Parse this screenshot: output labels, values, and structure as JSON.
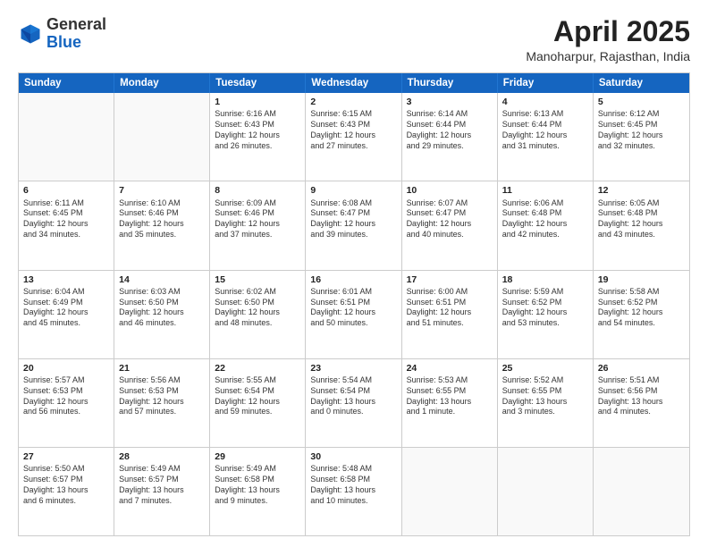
{
  "header": {
    "logo_general": "General",
    "logo_blue": "Blue",
    "month_title": "April 2025",
    "location": "Manoharpur, Rajasthan, India"
  },
  "weekdays": [
    "Sunday",
    "Monday",
    "Tuesday",
    "Wednesday",
    "Thursday",
    "Friday",
    "Saturday"
  ],
  "rows": [
    [
      {
        "day": "",
        "lines": []
      },
      {
        "day": "",
        "lines": []
      },
      {
        "day": "1",
        "lines": [
          "Sunrise: 6:16 AM",
          "Sunset: 6:43 PM",
          "Daylight: 12 hours",
          "and 26 minutes."
        ]
      },
      {
        "day": "2",
        "lines": [
          "Sunrise: 6:15 AM",
          "Sunset: 6:43 PM",
          "Daylight: 12 hours",
          "and 27 minutes."
        ]
      },
      {
        "day": "3",
        "lines": [
          "Sunrise: 6:14 AM",
          "Sunset: 6:44 PM",
          "Daylight: 12 hours",
          "and 29 minutes."
        ]
      },
      {
        "day": "4",
        "lines": [
          "Sunrise: 6:13 AM",
          "Sunset: 6:44 PM",
          "Daylight: 12 hours",
          "and 31 minutes."
        ]
      },
      {
        "day": "5",
        "lines": [
          "Sunrise: 6:12 AM",
          "Sunset: 6:45 PM",
          "Daylight: 12 hours",
          "and 32 minutes."
        ]
      }
    ],
    [
      {
        "day": "6",
        "lines": [
          "Sunrise: 6:11 AM",
          "Sunset: 6:45 PM",
          "Daylight: 12 hours",
          "and 34 minutes."
        ]
      },
      {
        "day": "7",
        "lines": [
          "Sunrise: 6:10 AM",
          "Sunset: 6:46 PM",
          "Daylight: 12 hours",
          "and 35 minutes."
        ]
      },
      {
        "day": "8",
        "lines": [
          "Sunrise: 6:09 AM",
          "Sunset: 6:46 PM",
          "Daylight: 12 hours",
          "and 37 minutes."
        ]
      },
      {
        "day": "9",
        "lines": [
          "Sunrise: 6:08 AM",
          "Sunset: 6:47 PM",
          "Daylight: 12 hours",
          "and 39 minutes."
        ]
      },
      {
        "day": "10",
        "lines": [
          "Sunrise: 6:07 AM",
          "Sunset: 6:47 PM",
          "Daylight: 12 hours",
          "and 40 minutes."
        ]
      },
      {
        "day": "11",
        "lines": [
          "Sunrise: 6:06 AM",
          "Sunset: 6:48 PM",
          "Daylight: 12 hours",
          "and 42 minutes."
        ]
      },
      {
        "day": "12",
        "lines": [
          "Sunrise: 6:05 AM",
          "Sunset: 6:48 PM",
          "Daylight: 12 hours",
          "and 43 minutes."
        ]
      }
    ],
    [
      {
        "day": "13",
        "lines": [
          "Sunrise: 6:04 AM",
          "Sunset: 6:49 PM",
          "Daylight: 12 hours",
          "and 45 minutes."
        ]
      },
      {
        "day": "14",
        "lines": [
          "Sunrise: 6:03 AM",
          "Sunset: 6:50 PM",
          "Daylight: 12 hours",
          "and 46 minutes."
        ]
      },
      {
        "day": "15",
        "lines": [
          "Sunrise: 6:02 AM",
          "Sunset: 6:50 PM",
          "Daylight: 12 hours",
          "and 48 minutes."
        ]
      },
      {
        "day": "16",
        "lines": [
          "Sunrise: 6:01 AM",
          "Sunset: 6:51 PM",
          "Daylight: 12 hours",
          "and 50 minutes."
        ]
      },
      {
        "day": "17",
        "lines": [
          "Sunrise: 6:00 AM",
          "Sunset: 6:51 PM",
          "Daylight: 12 hours",
          "and 51 minutes."
        ]
      },
      {
        "day": "18",
        "lines": [
          "Sunrise: 5:59 AM",
          "Sunset: 6:52 PM",
          "Daylight: 12 hours",
          "and 53 minutes."
        ]
      },
      {
        "day": "19",
        "lines": [
          "Sunrise: 5:58 AM",
          "Sunset: 6:52 PM",
          "Daylight: 12 hours",
          "and 54 minutes."
        ]
      }
    ],
    [
      {
        "day": "20",
        "lines": [
          "Sunrise: 5:57 AM",
          "Sunset: 6:53 PM",
          "Daylight: 12 hours",
          "and 56 minutes."
        ]
      },
      {
        "day": "21",
        "lines": [
          "Sunrise: 5:56 AM",
          "Sunset: 6:53 PM",
          "Daylight: 12 hours",
          "and 57 minutes."
        ]
      },
      {
        "day": "22",
        "lines": [
          "Sunrise: 5:55 AM",
          "Sunset: 6:54 PM",
          "Daylight: 12 hours",
          "and 59 minutes."
        ]
      },
      {
        "day": "23",
        "lines": [
          "Sunrise: 5:54 AM",
          "Sunset: 6:54 PM",
          "Daylight: 13 hours",
          "and 0 minutes."
        ]
      },
      {
        "day": "24",
        "lines": [
          "Sunrise: 5:53 AM",
          "Sunset: 6:55 PM",
          "Daylight: 13 hours",
          "and 1 minute."
        ]
      },
      {
        "day": "25",
        "lines": [
          "Sunrise: 5:52 AM",
          "Sunset: 6:55 PM",
          "Daylight: 13 hours",
          "and 3 minutes."
        ]
      },
      {
        "day": "26",
        "lines": [
          "Sunrise: 5:51 AM",
          "Sunset: 6:56 PM",
          "Daylight: 13 hours",
          "and 4 minutes."
        ]
      }
    ],
    [
      {
        "day": "27",
        "lines": [
          "Sunrise: 5:50 AM",
          "Sunset: 6:57 PM",
          "Daylight: 13 hours",
          "and 6 minutes."
        ]
      },
      {
        "day": "28",
        "lines": [
          "Sunrise: 5:49 AM",
          "Sunset: 6:57 PM",
          "Daylight: 13 hours",
          "and 7 minutes."
        ]
      },
      {
        "day": "29",
        "lines": [
          "Sunrise: 5:49 AM",
          "Sunset: 6:58 PM",
          "Daylight: 13 hours",
          "and 9 minutes."
        ]
      },
      {
        "day": "30",
        "lines": [
          "Sunrise: 5:48 AM",
          "Sunset: 6:58 PM",
          "Daylight: 13 hours",
          "and 10 minutes."
        ]
      },
      {
        "day": "",
        "lines": []
      },
      {
        "day": "",
        "lines": []
      },
      {
        "day": "",
        "lines": []
      }
    ]
  ]
}
